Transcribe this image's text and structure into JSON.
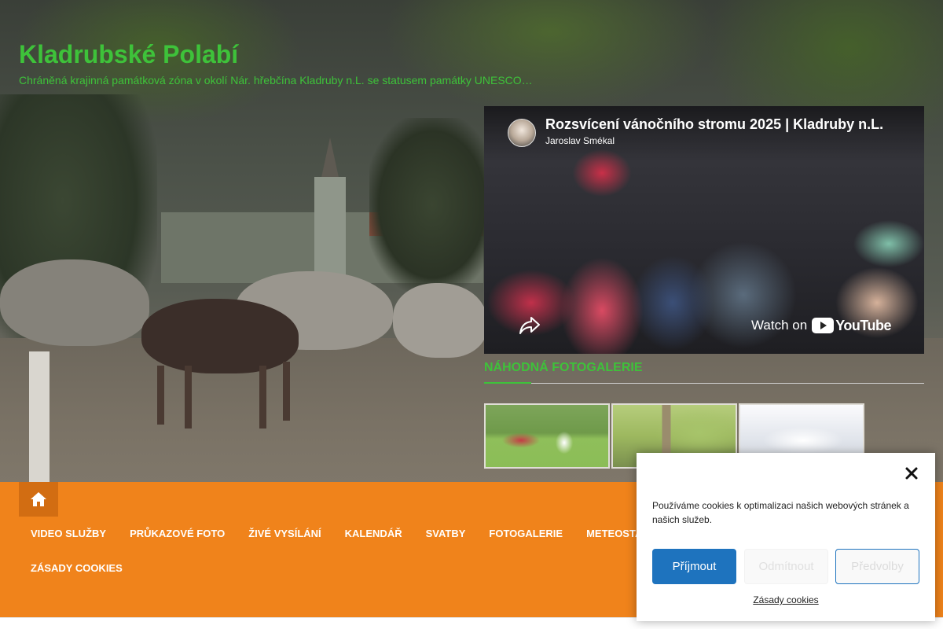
{
  "site": {
    "title": "Kladrubské Polabí",
    "tagline": "Chráněná krajinná památková zóna v okolí Nár. hřebčína Kladruby n.L. se statusem památky UNESCO…"
  },
  "video": {
    "title": "Rozsvícení vánočního stromu 2025 | Kladruby n.L.",
    "channel": "Jaroslav Smékal",
    "watch_on": "Watch on",
    "platform": "YouTube",
    "icons": {
      "share": "share-icon",
      "logo": "youtube-logo-icon"
    }
  },
  "gallery": {
    "heading": "NÁHODNÁ FOTOGALERIE",
    "thumbnails": [
      {
        "name": "gallery-thumb-horse-riding"
      },
      {
        "name": "gallery-thumb-trees"
      },
      {
        "name": "gallery-thumb-winter-carriage"
      }
    ]
  },
  "nav": {
    "home_icon": "home-icon",
    "items_row1": [
      "VIDEO SLUŽBY",
      "PRŮKAZOVÉ FOTO",
      "ŽIVÉ VYSÍLÁNÍ",
      "KALENDÁŘ",
      "SVATBY",
      "FOTOGALERIE",
      "METEOSTA"
    ],
    "items_row2": [
      "ZÁSADY COOKIES"
    ]
  },
  "cookie": {
    "text": "Používáme cookies k optimalizaci našich webových stránek a našich služeb.",
    "accept": "Příjmout",
    "deny": "Odmítnout",
    "preferences": "Předvolby",
    "policy_link": "Zásady cookies",
    "close_icon": "close-icon"
  },
  "colors": {
    "brand_green": "#3ec23a",
    "nav_orange": "#f0831b",
    "home_orange": "#d26d12",
    "accept_blue": "#1e73be"
  }
}
